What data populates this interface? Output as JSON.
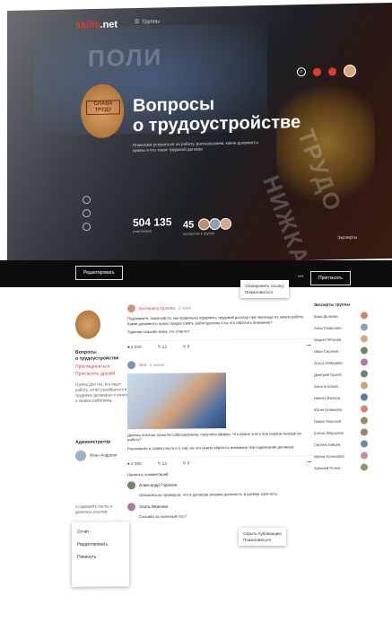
{
  "app": {
    "logo_left": "skills",
    "logo_right": ".net",
    "menu_label": "Группы"
  },
  "hero": {
    "stamp_text": "СЛАВА ТРУДУ",
    "title_line1": "Вопросы",
    "title_line2": "о трудоустройстве",
    "description": "Помогаем устроиться на работу, рассказываем, какие документы нужны и что такое трудовой договор",
    "stat_members": "504 135",
    "stat_members_label": "участников",
    "stat_experts": "45",
    "stat_experts_label": "экспертов в группе",
    "right_label": "Эксперты",
    "bg_texts": [
      "ПОЛИ",
      "ТРУДО",
      "НИЖКА"
    ]
  },
  "strip": {
    "left_button": "Редактировать",
    "right_button": "Пригласить"
  },
  "popup1": {
    "item1": "Скопировать ссылку",
    "item2": "Пожаловаться"
  },
  "sidebar": {
    "stamp_label": "СЛАВА ТРУДУ",
    "title_line1": "Вопросы",
    "title_line2": "о трудоустройстве",
    "link1": "Присоединиться",
    "link2": "Пригласить друзей",
    "text": "Группа для тех, кто ищет работу, хочет разобраться в трудовых договорах и узнать о правах работника.",
    "admins_heading": "Администратор",
    "admin_name": "Иван Андреев",
    "bottom_text": "Создавайте посты и делитесь опытом"
  },
  "dropdown": {
    "items": [
      "Отчёт",
      "Редактировать",
      "Покинуть"
    ]
  },
  "posts": [
    {
      "author": "Екатерина Орлова",
      "time": "2 часа",
      "text": "Подскажите, пожалуйста, как правильно оформить трудовой договор при переходе на новую работу. Какие документы нужно предоставить работодателю и на что обратить внимание?",
      "text2": "Заранее спасибо всем, кто ответит!",
      "likes": "4 030",
      "comments": "12",
      "shares": "8"
    },
    {
      "author": "Ася",
      "time": "5 часов",
      "text": "Делюсь опытом: прошла собеседование, получила оффер. Что важно знать при первом выходе на работу?",
      "text2": "Расскажите о своём опыте и о том, на что нужно обратить внимание при подписании договора.",
      "likes": "4 030",
      "comments": "12",
      "shares": "8",
      "comment_section_title": "Написать комментарий",
      "comment1_author": "Александр Горюнов",
      "comment1_text": "Обязательно проверьте, что в договоре указана должность и размер зарплаты.",
      "comment2_author": "Злата Иванова",
      "comment2_text": "Спасибо за полезный пост!"
    }
  ],
  "popup2": {
    "item1": "Скрыть публикацию",
    "item2": "Пожаловаться"
  },
  "rightcol": {
    "heading": "Эксперты группы",
    "people": [
      "Кира Дьякова",
      "Анна Смирнова",
      "Мария Петрова",
      "Иван Сергеев",
      "Ольга Лебедева",
      "Дмитрий Орлов",
      "Анна Козлова",
      "Никита Волков",
      "Юлия Новикова",
      "Павел Морозов",
      "Елена Фёдорова",
      "Сергей Зайцев",
      "Ирина Кузнецова",
      "Алексей Попов"
    ],
    "avatar_colors": [
      "#c98b6e",
      "#8aa0b8",
      "#d4a88a",
      "#6f8a5e",
      "#b07a9a",
      "#7a7a7a",
      "#c9a47a",
      "#5e7aa8",
      "#d08a6a",
      "#9a8a6a",
      "#a87a6a",
      "#6a8aa8",
      "#c98a9a",
      "#8a9a6a"
    ]
  },
  "colors": {
    "accent": "#e53a2f",
    "hero_dark": "#1d2126",
    "strip": "#0d0d0d"
  }
}
